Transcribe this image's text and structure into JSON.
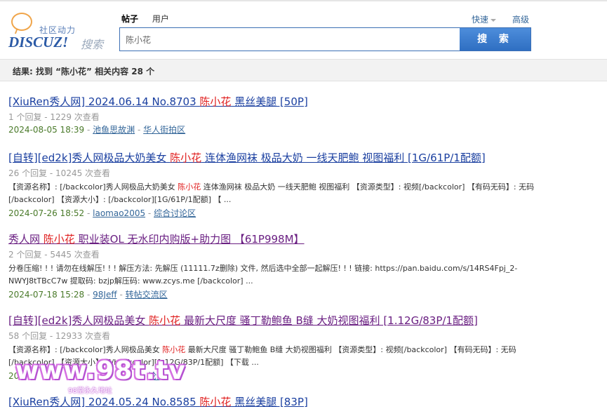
{
  "logo": {
    "tagline": "社区动力",
    "brand": "DISCUZ!",
    "suffix": "搜索"
  },
  "tabs": [
    {
      "label": "帖子",
      "active": true
    },
    {
      "label": "用户",
      "active": false
    }
  ],
  "quick_label": "快速",
  "advanced_label": "高级",
  "search": {
    "value": "陈小花",
    "button_label": "搜 索"
  },
  "result_summary": "结果: 找到 “陈小花” 相关内容 28 个",
  "results": [
    {
      "title_pre": "[XiuRen秀人网] 2024.06.14 No.8703 ",
      "title_hl": "陈小花",
      "title_post": " 黑丝美腿 [50P]",
      "meta": "1 个回复 - 1229 次查看",
      "snippet_pre": "",
      "snippet_hl": "",
      "snippet_post": "",
      "date": "2024-08-05 18:39",
      "author": "池鱼思故渊",
      "forum": "华人街拍区"
    },
    {
      "title_pre": "[自转][ed2k]秀人网极品大奶美女 ",
      "title_hl": "陈小花",
      "title_post": " 连体渔网袜 极品大奶 一线天肥鲍 视图福利 [1G/61P/1配额]",
      "meta": "26 个回复 - 10245 次查看",
      "snippet_pre": "【资源名称】: [/backcolor]秀人网极品大奶美女 ",
      "snippet_hl": "陈小花",
      "snippet_post": " 连体渔网袜 极品大奶 一线天肥鲍 视图福利 【资源类型】: 视频[/backcolor] 【有码无码】: 无码[/backcolor] 【资源大小】: [/backcolor][1G/61P/1配额] 【 ...",
      "date": "2024-07-26 18:52",
      "author": "laomao2005",
      "forum": "综合讨论区"
    },
    {
      "title_pre": "秀人网 ",
      "title_hl": "陈小花",
      "title_post": " 职业装OL 无水印内购版+助力图 【61P998M】",
      "meta": "2 个回复 - 5445 次查看",
      "snippet_pre": "分卷压缩! ! ! 请勿在线解压! ! ! 解压方法: 先解压 (11111.7z删除) 文件, 然后选中全部一起解压! ! ! 链接: https://pan.baidu.com/s/14RS4Fpj_2-NWYJ8tTBcC7w 提取码: bzjp解压码: www.zcys.me [/backcolor] ...",
      "snippet_hl": "",
      "snippet_post": "",
      "date": "2024-07-18 15:28",
      "author": "98Jeff",
      "forum": "转帖交流区"
    },
    {
      "title_pre": "[自转][ed2k]秀人网极品美女 ",
      "title_hl": "陈小花",
      "title_post": " 最新大尺度 骚丁勒鲍鱼 B缝 大奶视图福利 [1.12G/83P/1配额]",
      "meta": "58 个回复 - 12933 次查看",
      "snippet_pre": "【资源名称】: [/backcolor]秀人网极品美女 ",
      "snippet_hl": "陈小花",
      "snippet_post": " 最新大尺度 骚丁勒鲍鱼 B缝 大奶视图福利 【资源类型】: 视频[/backcolor] 【有码无码】: 无码[/backcolor] 【资源大小】: [/backcolor][1.12G/83P/1配额] 【下载 ...",
      "date": "20",
      "author": "",
      "forum": "论区"
    },
    {
      "title_pre": "[XiuRen秀人网] 2024.05.24 No.8585 ",
      "title_hl": "陈小花",
      "title_post": " 黑丝美腿 [83P]",
      "meta": "",
      "snippet_pre": "",
      "snippet_hl": "",
      "snippet_post": "",
      "date": "",
      "author": "",
      "forum": ""
    }
  ],
  "watermark": {
    "big": "www.98t.tv",
    "small": "98堂永久地址"
  }
}
